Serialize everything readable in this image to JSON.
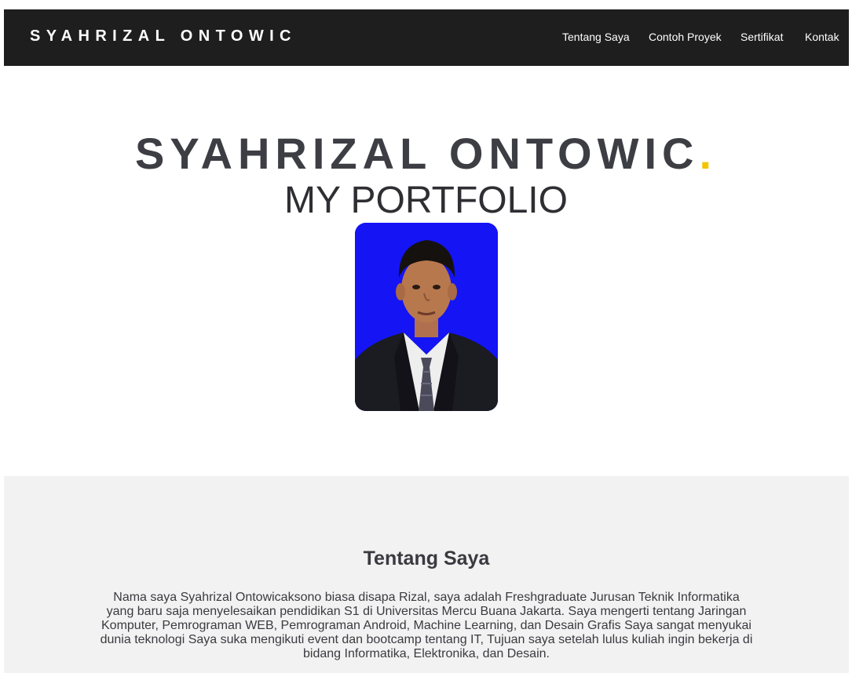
{
  "navbar": {
    "brand": "SYAHRIZAL ONTOWIC",
    "items": [
      {
        "label": "Tentang Saya"
      },
      {
        "label": "Contoh Proyek"
      },
      {
        "label": "Sertifikat"
      },
      {
        "label": "Kontak"
      }
    ]
  },
  "hero": {
    "title": "SYAHRIZAL ONTOWIC",
    "title_dot": ".",
    "subtitle": "MY PORTFOLIO"
  },
  "about": {
    "heading": "Tentang Saya",
    "text": "Nama saya Syahrizal Ontowicaksono biasa disapa Rizal, saya adalah Freshgraduate Jurusan Teknik Informatika yang baru saja menyelesaikan pendidikan S1 di Universitas Mercu Buana Jakarta. Saya mengerti tentang Jaringan Komputer, Pemrograman WEB, Pemrograman Android, Machine Learning, dan Desain Grafis Saya sangat menyukai dunia teknologi Saya suka mengikuti event dan bootcamp tentang IT, Tujuan saya setelah lulus kuliah ingin bekerja di bidang Informatika, Elektronika, dan Desain."
  },
  "colors": {
    "navbar_bg": "#1e1e1e",
    "accent_dot": "#f2c500",
    "photo_bg": "#1414f5",
    "about_bg": "#f2f2f2",
    "text_dark": "#3a3a40"
  }
}
